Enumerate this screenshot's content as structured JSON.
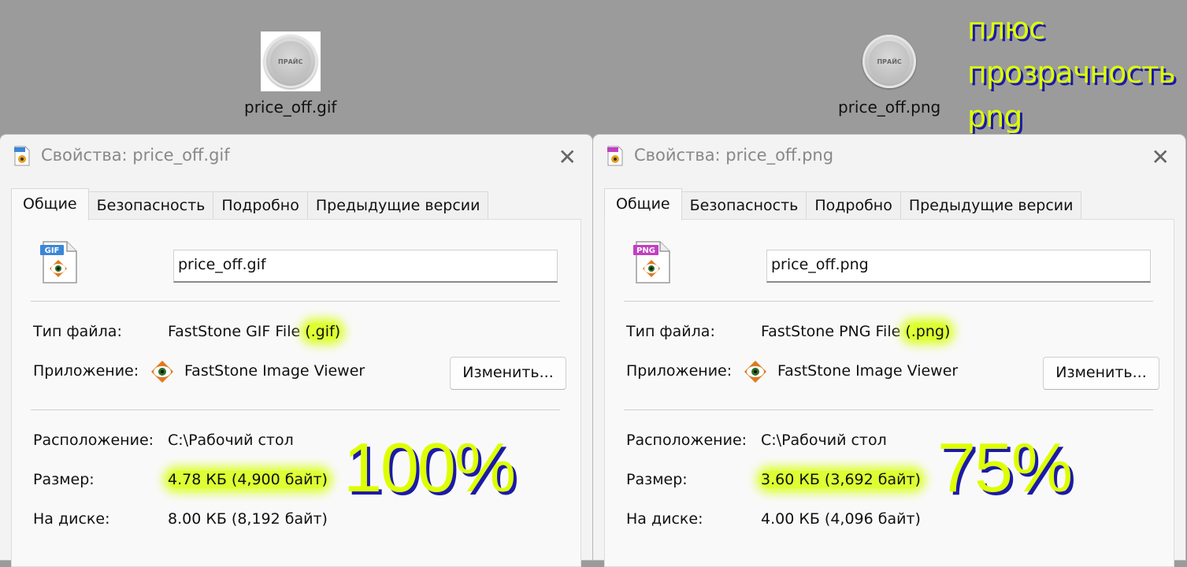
{
  "desktop": {
    "gif_icon": {
      "label": "price_off.gif",
      "button_text": "ПРАЙС"
    },
    "png_icon": {
      "label": "price_off.png",
      "button_text": "ПРАЙС"
    },
    "promo_lines": [
      "плюс",
      "прозрачность",
      "png"
    ]
  },
  "dialog_gif": {
    "title": "Свойства: price_off.gif",
    "tabs": [
      "Общие",
      "Безопасность",
      "Подробно",
      "Предыдущие версии"
    ],
    "file_badge": "GIF",
    "filename": "price_off.gif",
    "type_label": "Тип файла:",
    "type_value": "FastStone GIF File ",
    "type_ext": "(.gif)",
    "app_label": "Приложение:",
    "app_value": "FastStone Image Viewer",
    "change_button": "Изменить...",
    "location_label": "Расположение:",
    "location_value": "C:\\Рабочий стол",
    "size_label": "Размер:",
    "size_value": "4.78 КБ (4,900 байт)",
    "disk_label": "На диске:",
    "disk_value": "8.00 КБ (8,192 байт)",
    "percent": "100%"
  },
  "dialog_png": {
    "title": "Свойства: price_off.png",
    "tabs": [
      "Общие",
      "Безопасность",
      "Подробно",
      "Предыдущие версии"
    ],
    "file_badge": "PNG",
    "filename": "price_off.png",
    "type_label": "Тип файла:",
    "type_value": "FastStone PNG File ",
    "type_ext": "(.png)",
    "app_label": "Приложение:",
    "app_value": "FastStone Image Viewer",
    "change_button": "Изменить...",
    "location_label": "Расположение:",
    "location_value": "C:\\Рабочий стол",
    "size_label": "Размер:",
    "size_value": "3.60 КБ (3,692 байт)",
    "disk_label": "На диске:",
    "disk_value": "4.00 КБ (4,096 байт)",
    "percent": "75%"
  },
  "colors": {
    "highlight": "#ddff33",
    "promo_text": "#ddff00",
    "promo_shadow": "#1a1aa8",
    "gif_badge": "#3a86d8",
    "png_badge": "#c23fc2"
  }
}
